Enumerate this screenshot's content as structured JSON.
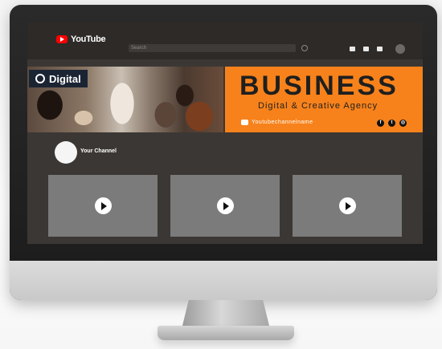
{
  "header": {
    "logo_text": "YouTube",
    "search_placeholder": "Search",
    "icons": [
      "video-camera-icon",
      "apps-grid-icon",
      "bell-icon",
      "account-avatar"
    ]
  },
  "banner": {
    "tag": "Digital",
    "title": "BUSINESS",
    "subtitle": "Digital & Creative Agency",
    "channel_name": "Youtubechannelname",
    "socials": [
      "facebook",
      "twitter",
      "instagram"
    ],
    "accent": "#f7821b"
  },
  "channel": {
    "label": "Your Channel"
  },
  "videos": [
    {
      "icon": "play-icon"
    },
    {
      "icon": "play-icon"
    },
    {
      "icon": "play-icon"
    }
  ]
}
